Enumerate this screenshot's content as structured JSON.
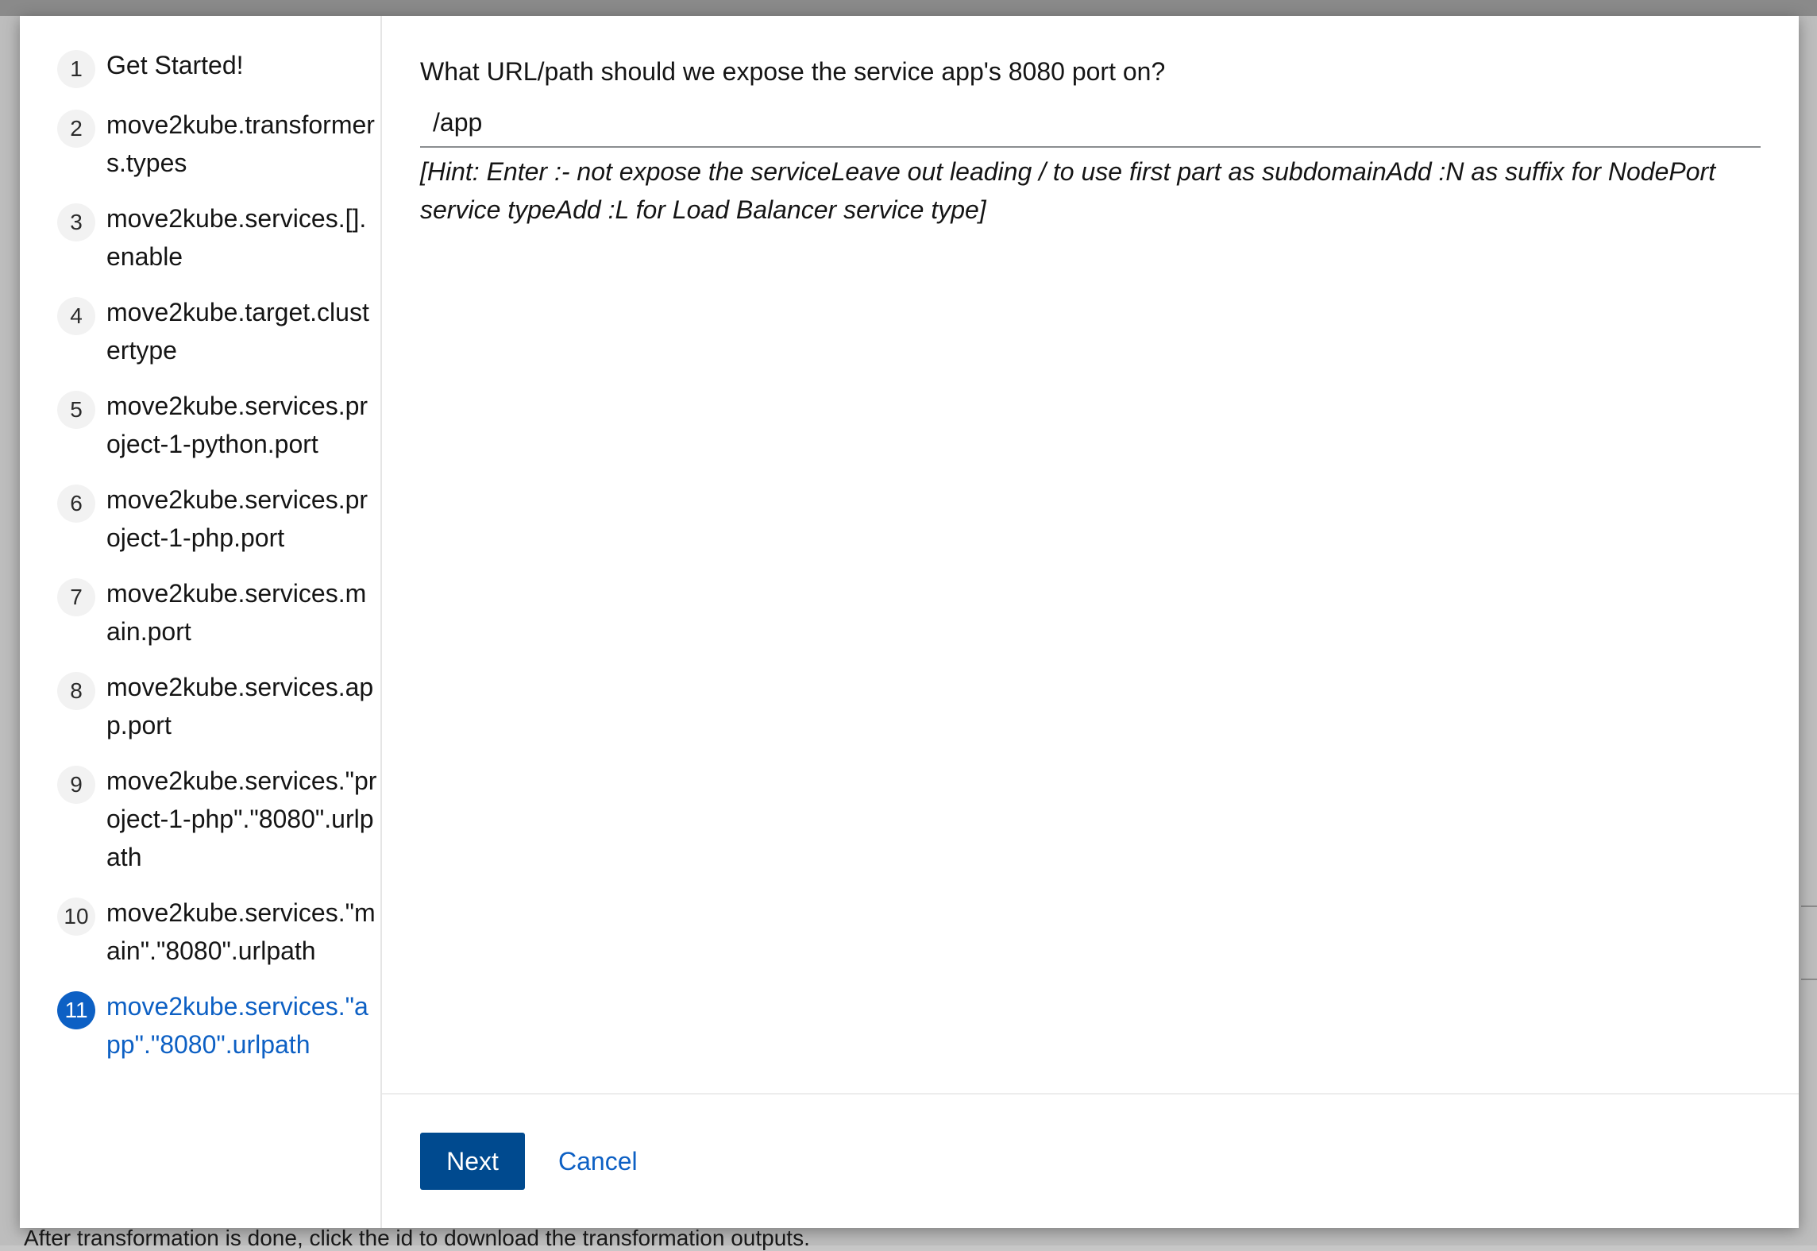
{
  "background": {
    "text": "After transformation is done, click the id to download the transformation outputs."
  },
  "wizard": {
    "steps": [
      {
        "number": "1",
        "label": "Get Started!"
      },
      {
        "number": "2",
        "label": "move2kube.transformers.types"
      },
      {
        "number": "3",
        "label": "move2kube.services.[].enable"
      },
      {
        "number": "4",
        "label": "move2kube.target.clustertype"
      },
      {
        "number": "5",
        "label": "move2kube.services.project-1-python.port"
      },
      {
        "number": "6",
        "label": "move2kube.services.project-1-php.port"
      },
      {
        "number": "7",
        "label": "move2kube.services.main.port"
      },
      {
        "number": "8",
        "label": "move2kube.services.app.port"
      },
      {
        "number": "9",
        "label": "move2kube.services.\"project-1-php\".\"8080\".urlpath"
      },
      {
        "number": "10",
        "label": "move2kube.services.\"main\".\"8080\".urlpath"
      },
      {
        "number": "11",
        "label": "move2kube.services.\"app\".\"8080\".urlpath"
      }
    ],
    "current_step": "11"
  },
  "question": {
    "text": "What URL/path should we expose the service app's 8080 port on?",
    "input_value": "/app",
    "hint": "[Hint: Enter :- not expose the serviceLeave out leading / to use first part as subdomainAdd :N as suffix for NodePort service typeAdd :L for Load Balancer service type]"
  },
  "footer": {
    "next_label": "Next",
    "cancel_label": "Cancel"
  },
  "colors": {
    "accent": "#0d60c4",
    "primary_button": "#004a8f"
  }
}
